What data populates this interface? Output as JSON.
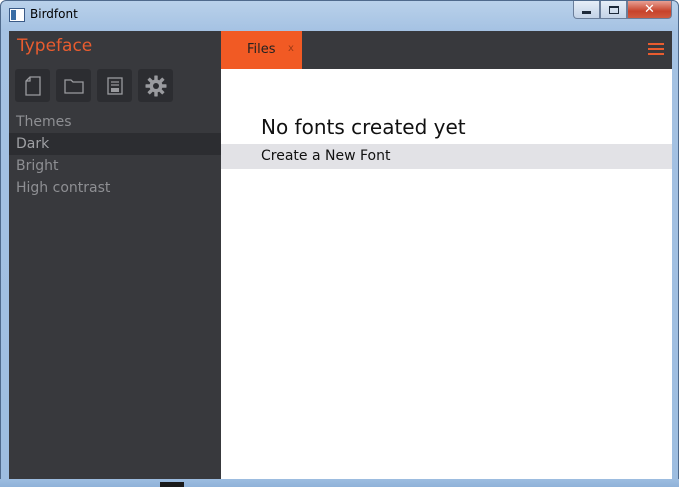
{
  "window": {
    "title": "Birdfont",
    "minimize_icon": "minimize-icon",
    "maximize_icon": "maximize-icon",
    "close_icon": "close-icon",
    "close_glyph": "✕"
  },
  "sidebar": {
    "app_name": "Typeface",
    "toolbar": [
      {
        "name": "new-file-icon"
      },
      {
        "name": "open-folder-icon"
      },
      {
        "name": "save-icon"
      },
      {
        "name": "settings-gear-icon"
      }
    ],
    "themes_header": "Themes",
    "themes": [
      {
        "label": "Dark",
        "selected": true
      },
      {
        "label": "Bright",
        "selected": false
      },
      {
        "label": "High contrast",
        "selected": false
      }
    ]
  },
  "tabs": {
    "files_label": "Files",
    "close_glyph": "x",
    "menu_icon": "hamburger-menu-icon"
  },
  "main": {
    "empty_title": "No fonts created yet",
    "create_label": "Create a New Font"
  },
  "colors": {
    "accent": "#f15a24",
    "sidebar_bg": "#38393d",
    "selected_bg": "#2c2d31",
    "row_highlight": "#e2e2e6"
  }
}
